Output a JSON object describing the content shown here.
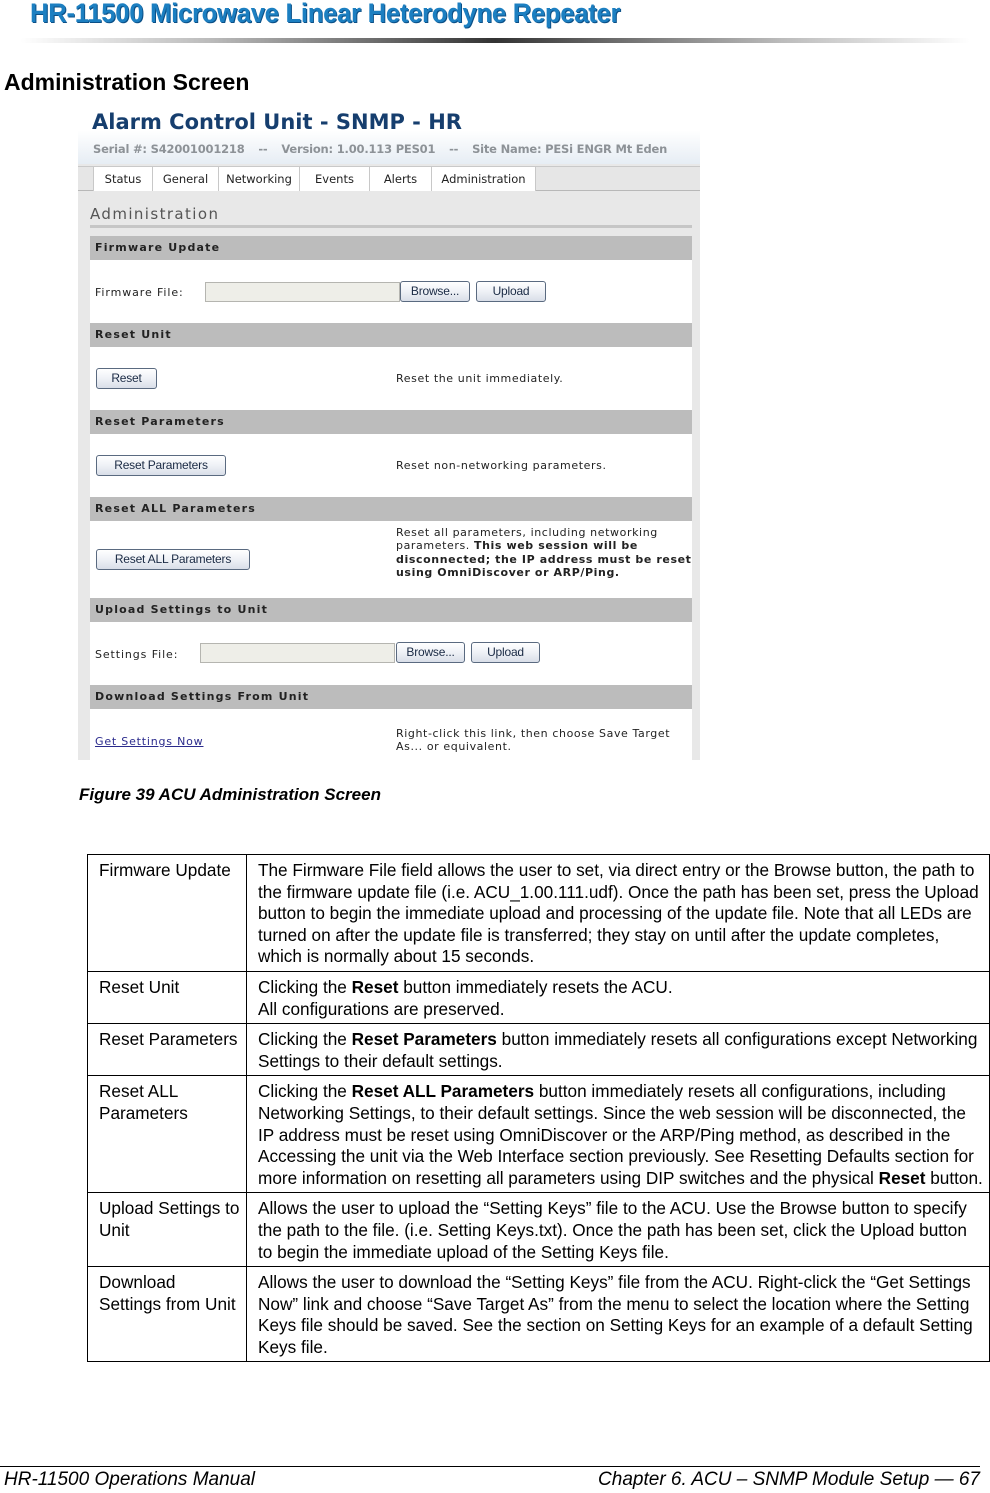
{
  "doc_header": {
    "title": "HR-11500 Microwave Linear Heterodyne Repeater",
    "title_color": "#1c7fc1"
  },
  "section_heading": "Administration Screen",
  "acu_screen": {
    "title": "Alarm Control Unit - SNMP - HR",
    "title_color": "#163e6e",
    "serial": "Serial #: S42001001218",
    "sep1": "--",
    "version": "Version: 1.00.113 PES01",
    "sep2": "--",
    "site_name": "Site Name:  PESi ENGR Mt Eden",
    "tabs": [
      {
        "label": "Status"
      },
      {
        "label": "General"
      },
      {
        "label": "Networking"
      },
      {
        "label": "Events"
      },
      {
        "label": "Alerts"
      },
      {
        "label": "Administration",
        "active": true
      }
    ],
    "page_title": "Administration",
    "sections": {
      "firmware": {
        "heading": "Firmware Update",
        "file_label": "Firmware File:",
        "file_value": "",
        "browse_label": "Browse...",
        "upload_label": "Upload"
      },
      "reset_unit": {
        "heading": "Reset Unit",
        "button_label": "Reset",
        "description": "Reset the unit immediately."
      },
      "reset_params": {
        "heading": "Reset Parameters",
        "button_label": "Reset Parameters",
        "description": "Reset non-networking parameters."
      },
      "reset_all": {
        "heading": "Reset ALL Parameters",
        "button_label": "Reset ALL Parameters",
        "description_plain": "Reset all parameters, including networking parameters. ",
        "description_bold": "This web session will be disconnected; the IP address must be reset using OmniDiscover or ARP/Ping."
      },
      "upload_settings": {
        "heading": "Upload Settings to Unit",
        "file_label": "Settings File:",
        "file_value": "",
        "browse_label": "Browse...",
        "upload_label": "Upload"
      },
      "download_settings": {
        "heading": "Download Settings From Unit",
        "link_label": "Get Settings Now",
        "description": "Right-click this link, then choose Save Target As... or equivalent."
      }
    }
  },
  "figure_caption": "Figure 39  ACU Administration Screen",
  "table": {
    "rows": [
      {
        "name": "Firmware Update",
        "parts": [
          {
            "text": "The Firmware File field allows the user to set, via direct entry or the Browse button, the path to the firmware update file (i.e. ACU_1.00.111.udf). Once the path has been set, press the Upload button to begin the immediate upload and processing of the update file. Note that all LEDs are turned on after the update file is transferred; they stay on until after the update completes, which is normally about 15 seconds."
          }
        ]
      },
      {
        "name": "Reset Unit",
        "parts": [
          {
            "text": "Clicking the "
          },
          {
            "text": "Reset",
            "bold": true
          },
          {
            "text": " button immediately resets the ACU."
          },
          {
            "br": true
          },
          {
            "text": "All configurations are preserved."
          }
        ]
      },
      {
        "name": "Reset Parameters",
        "parts": [
          {
            "text": "Clicking the "
          },
          {
            "text": "Reset Parameters",
            "bold": true
          },
          {
            "text": " button immediately resets all configurations except Networking Settings to their default settings."
          }
        ]
      },
      {
        "name": "Reset ALL Parameters",
        "parts": [
          {
            "text": "Clicking the "
          },
          {
            "text": "Reset ALL Parameters",
            "bold": true
          },
          {
            "text": " button immediately resets all configurations, including Networking Settings, to their default settings. Since the web session will be disconnected, the IP address must be reset using OmniDiscover or the ARP/Ping method, as described in the Accessing the unit via the Web Interface section previously. See Resetting Defaults section for more information on resetting all parameters using DIP switches and the physical "
          },
          {
            "text": "Reset",
            "bold": true
          },
          {
            "text": " button."
          }
        ]
      },
      {
        "name": "Upload Settings to Unit",
        "parts": [
          {
            "text": "Allows the user to upload the “Setting Keys” file to the ACU. Use the Browse button to specify the path to the file. (i.e. Setting Keys.txt). Once the path has been set, click the Upload button to begin the immediate upload of the Setting Keys file."
          }
        ]
      },
      {
        "name": "Download Settings from Unit",
        "parts": [
          {
            "text": "Allows the user to download the “Setting Keys” file from the ACU. Right-click the “Get Settings Now” link and choose “Save Target As” from the menu to select the location where the Setting Keys file should be saved. See the section on Setting Keys for an example of a default Setting Keys file."
          }
        ]
      }
    ]
  },
  "footer": {
    "left": "HR-11500 Operations Manual",
    "right": "Chapter 6. ACU – SNMP Module Setup — 67"
  }
}
